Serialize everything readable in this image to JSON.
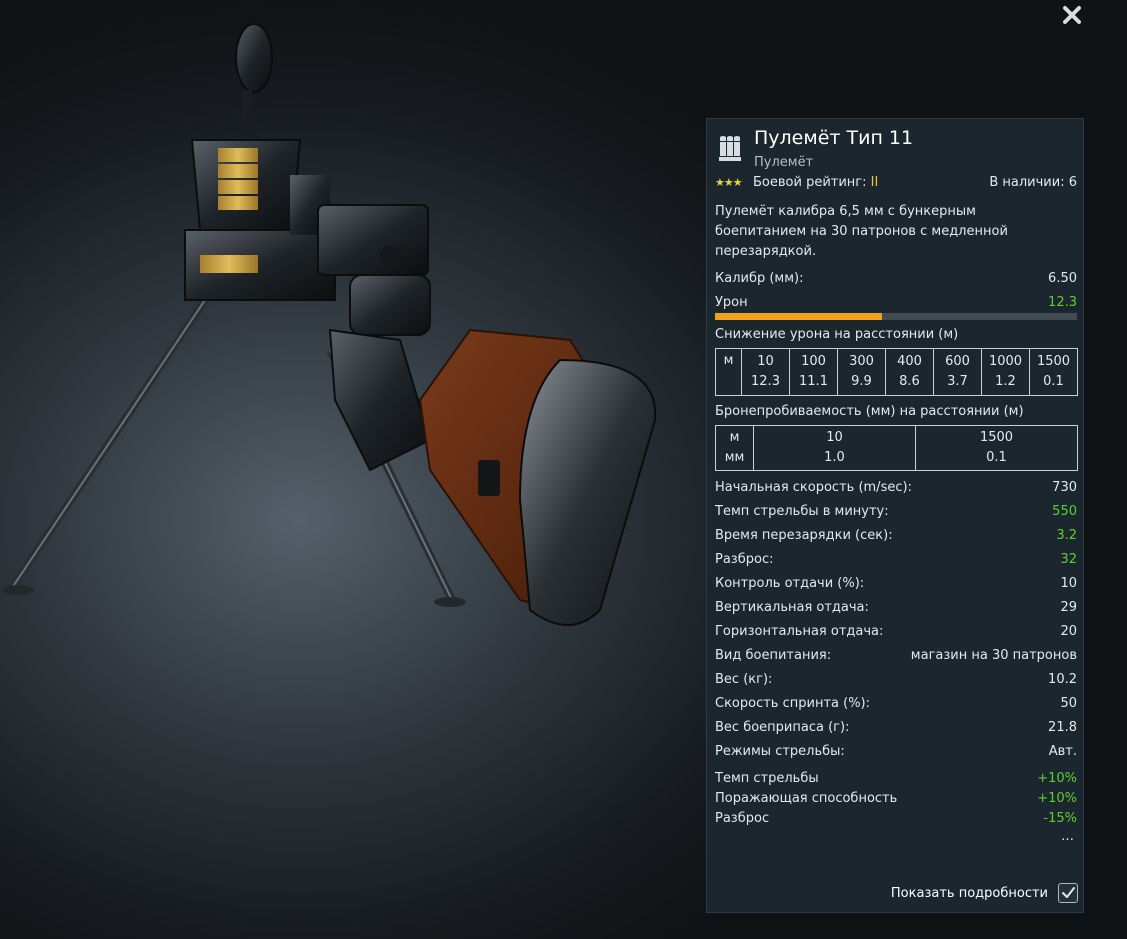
{
  "window": {
    "close_icon": "close-icon"
  },
  "weapon": {
    "title": "Пулемёт Тип 11",
    "subtitle": "Пулемёт",
    "icon": "ammo-icon",
    "stars_icon": "three-stars-icon",
    "rating_label": "Боевой рейтинг:",
    "rating_value": "II",
    "stock_label": "В наличии:",
    "stock_value": "6",
    "description": "Пулемёт калибра 6,5 мм с бункерным боепитанием на 30 патронов с медленной перезарядкой."
  },
  "caliber": {
    "label": "Калибр (мм):",
    "value": "6.50"
  },
  "damage": {
    "label": "Урон",
    "value": "12.3",
    "bar_fraction": 0.46
  },
  "damage_falloff": {
    "title": "Снижение урона на расстоянии (м)",
    "unit": "м",
    "distances": [
      "10",
      "100",
      "300",
      "400",
      "600",
      "1000",
      "1500"
    ],
    "values": [
      "12.3",
      "11.1",
      "9.9",
      "8.6",
      "3.7",
      "1.2",
      "0.1"
    ]
  },
  "penetration": {
    "title": "Бронепробиваемость (мм) на расстоянии (м)",
    "unit_top": "м",
    "unit_bottom": "мм",
    "distances": [
      "10",
      "1500"
    ],
    "values": [
      "1.0",
      "0.1"
    ]
  },
  "stats": [
    {
      "label": "Начальная скорость (m/sec):",
      "value": "730",
      "color": "#e6e9ec"
    },
    {
      "label": "Темп стрельбы в минуту:",
      "value": "550",
      "color": "#5cd12e"
    },
    {
      "label": "Время перезарядки (сек):",
      "value": "3.2",
      "color": "#5cd12e"
    },
    {
      "label": "Разброс:",
      "value": "32",
      "color": "#5cd12e"
    },
    {
      "label": "Контроль отдачи (%):",
      "value": "10",
      "color": "#e6e9ec"
    },
    {
      "label": "Вертикальная отдача:",
      "value": "29",
      "color": "#e6e9ec"
    },
    {
      "label": "Горизонтальная отдача:",
      "value": "20",
      "color": "#e6e9ec"
    },
    {
      "label": "Вид боепитания:",
      "value": "магазин на 30 патронов",
      "color": "#e6e9ec"
    },
    {
      "label": "Вес (кг):",
      "value": "10.2",
      "color": "#e6e9ec"
    },
    {
      "label": "Скорость спринта (%):",
      "value": "50",
      "color": "#e6e9ec"
    },
    {
      "label": "Вес боеприпаса (г):",
      "value": "21.8",
      "color": "#e6e9ec"
    },
    {
      "label": "Режимы стрельбы:",
      "value": "Авт.",
      "color": "#e6e9ec"
    }
  ],
  "modifiers": [
    {
      "label": "Темп стрельбы",
      "value": "+10%"
    },
    {
      "label": "Поражающая способность",
      "value": "+10%"
    },
    {
      "label": "Разброс",
      "value": "-15%"
    }
  ],
  "more": "…",
  "details": {
    "label": "Показать подробности",
    "checked": true,
    "check_icon": "checkmark-icon"
  },
  "colors": {
    "accent_bar": "#f0a21d",
    "positive": "#5cd12e",
    "rating": "#e4c23a",
    "panel_bg": "#1c262e"
  }
}
